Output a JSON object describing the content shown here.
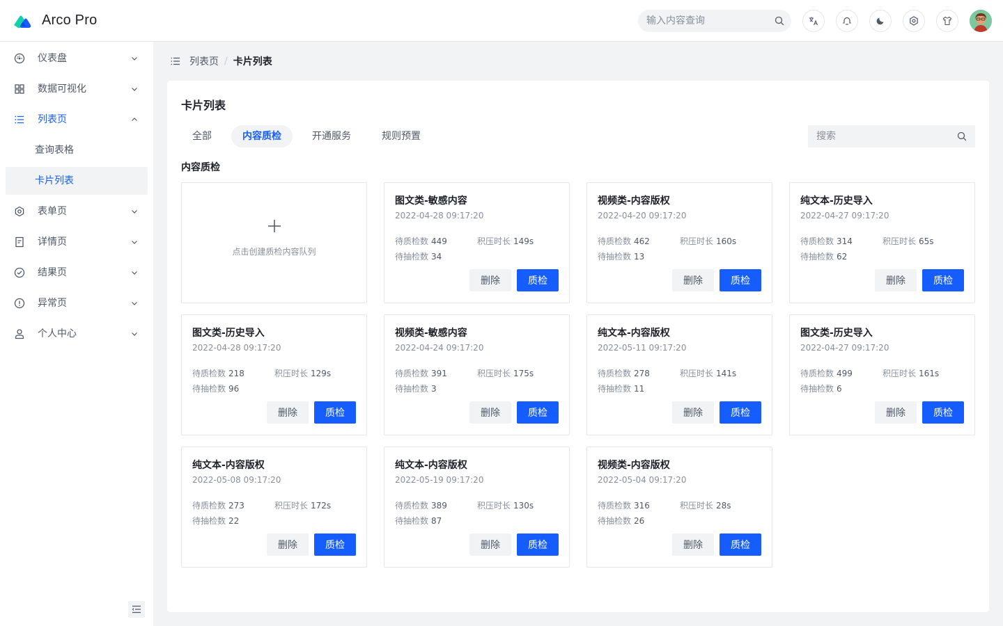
{
  "header": {
    "title": "Arco Pro",
    "search_placeholder": "输入内容查询",
    "icons": [
      "translate-icon",
      "bell-icon",
      "moon-icon",
      "settings-icon",
      "tshirt-icon"
    ],
    "accent_color": "#165dff"
  },
  "sidebar": {
    "items": [
      {
        "label": "仪表盘",
        "icon": "dashboard-icon"
      },
      {
        "label": "数据可视化",
        "icon": "grid-icon"
      },
      {
        "label": "列表页",
        "icon": "list-icon",
        "expanded": true
      },
      {
        "label": "查询表格",
        "sub": true
      },
      {
        "label": "卡片列表",
        "sub": true,
        "active": true
      },
      {
        "label": "表单页",
        "icon": "settings-icon"
      },
      {
        "label": "详情页",
        "icon": "file-icon"
      },
      {
        "label": "结果页",
        "icon": "check-circle-icon"
      },
      {
        "label": "异常页",
        "icon": "exclamation-circle-icon"
      },
      {
        "label": "个人中心",
        "icon": "user-icon"
      }
    ]
  },
  "breadcrumb": [
    "列表页",
    "卡片列表"
  ],
  "panel": {
    "title": "卡片列表",
    "tabs": [
      "全部",
      "内容质检",
      "开通服务",
      "规则预置"
    ],
    "active_tab": "内容质检",
    "search_placeholder": "搜索",
    "section_title": "内容质检",
    "add_text": "点击创建质检内容队列",
    "labels": {
      "pending": "待质检数",
      "backlog": "积压时长",
      "sample": "待抽检数",
      "delete": "删除",
      "inspect": "质检"
    },
    "cards": [
      {
        "title": "图文类-敏感内容",
        "time": "2022-04-28 09:17:20",
        "pending": "449",
        "backlog": "149s",
        "sample": "34"
      },
      {
        "title": "视频类-内容版权",
        "time": "2022-04-20 09:17:20",
        "pending": "462",
        "backlog": "160s",
        "sample": "13"
      },
      {
        "title": "纯文本-历史导入",
        "time": "2022-04-27 09:17:20",
        "pending": "314",
        "backlog": "65s",
        "sample": "62"
      },
      {
        "title": "图文类-历史导入",
        "time": "2022-04-28 09:17:20",
        "pending": "218",
        "backlog": "129s",
        "sample": "96"
      },
      {
        "title": "视频类-敏感内容",
        "time": "2022-04-24 09:17:20",
        "pending": "391",
        "backlog": "175s",
        "sample": "3"
      },
      {
        "title": "纯文本-内容版权",
        "time": "2022-05-11 09:17:20",
        "pending": "278",
        "backlog": "141s",
        "sample": "11"
      },
      {
        "title": "图文类-历史导入",
        "time": "2022-04-27 09:17:20",
        "pending": "499",
        "backlog": "161s",
        "sample": "6"
      },
      {
        "title": "纯文本-内容版权",
        "time": "2022-05-08 09:17:20",
        "pending": "273",
        "backlog": "172s",
        "sample": "22"
      },
      {
        "title": "纯文本-内容版权",
        "time": "2022-05-19 09:17:20",
        "pending": "389",
        "backlog": "130s",
        "sample": "87"
      },
      {
        "title": "视频类-内容版权",
        "time": "2022-05-04 09:17:20",
        "pending": "316",
        "backlog": "28s",
        "sample": "26"
      }
    ]
  }
}
